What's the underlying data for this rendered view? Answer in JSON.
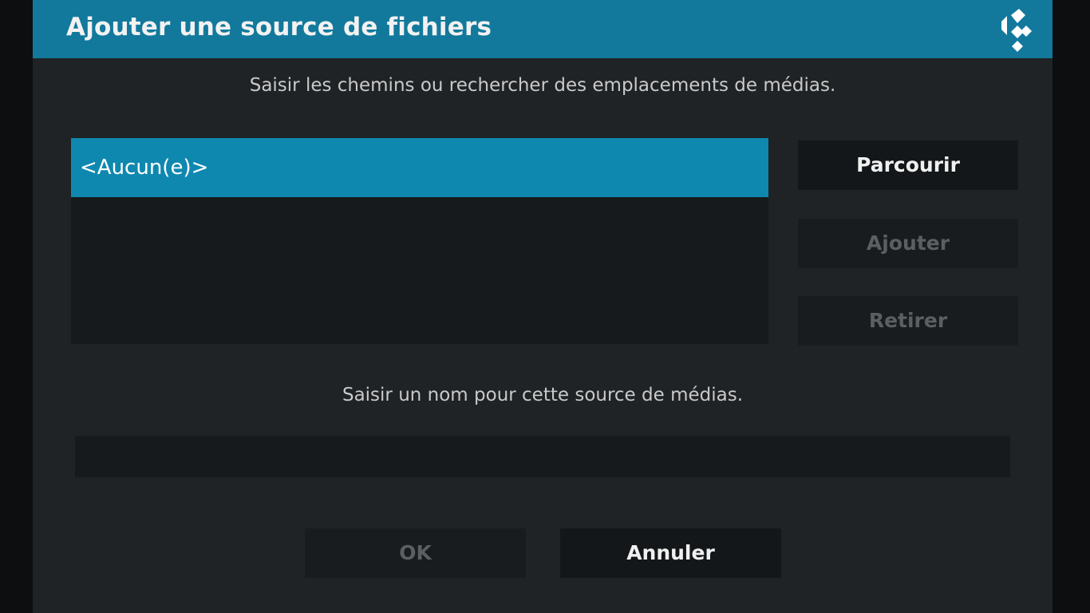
{
  "dialog": {
    "title": "Ajouter une source de fichiers",
    "logo_icon": "kodi-logo-icon",
    "accent_color": "#12799c"
  },
  "paths": {
    "heading": "Saisir les chemins ou rechercher des emplacements de médias.",
    "items": [
      {
        "label": "<Aucun(e)>",
        "selected": true
      }
    ]
  },
  "side_buttons": {
    "browse_label": "Parcourir",
    "add_label": "Ajouter",
    "remove_label": "Retirer"
  },
  "source_name": {
    "heading": "Saisir un nom pour cette source de médias.",
    "value": ""
  },
  "footer": {
    "ok_label": "OK",
    "cancel_label": "Annuler"
  }
}
